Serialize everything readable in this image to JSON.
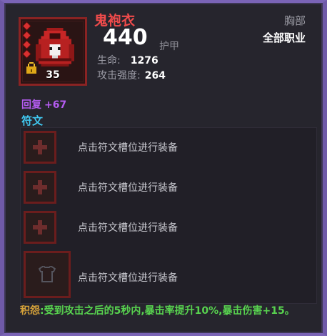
{
  "item": {
    "name": "鬼袍衣",
    "level": "35",
    "armor_value": "440",
    "armor_label": "护甲",
    "slot_type": "胸部",
    "class_req": "全部职业"
  },
  "stats": [
    {
      "label": "生命:",
      "value": "1276"
    },
    {
      "label": "攻击强度:",
      "value": "264"
    }
  ],
  "regen": {
    "label": "回复",
    "value": "+67"
  },
  "runes": {
    "title": "符文",
    "slots": [
      {
        "text": "点击符文槽位进行装备",
        "icon": "plus-icon"
      },
      {
        "text": "点击符文槽位进行装备",
        "icon": "plus-icon"
      },
      {
        "text": "点击符文槽位进行装备",
        "icon": "plus-icon"
      },
      {
        "text": "点击符文槽位进行装备",
        "icon": "armor-icon"
      }
    ]
  },
  "set_bonus": {
    "label": "积怨",
    "text": ":受到攻击之后的5秒内,暴击率提升10%,暴击伤害+15。"
  },
  "colors": {
    "frame": "#6f5aa8",
    "item_name": "#ef4b4b",
    "regen": "#b45cf0",
    "rune_title": "#41c8f0",
    "set_bonus": "#58d34f"
  }
}
